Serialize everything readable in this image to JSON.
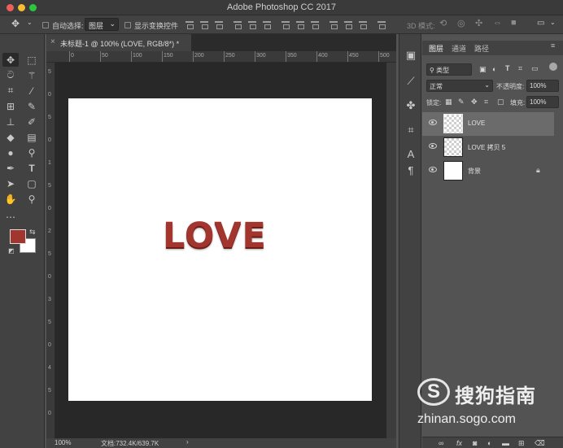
{
  "window": {
    "title": "Adobe Photoshop CC 2017",
    "traffic_colors": [
      "#ee5f57",
      "#f5bd2f",
      "#2bc640"
    ]
  },
  "options": {
    "auto_select_label": "自动选择:",
    "auto_select_value": "图层",
    "show_transform_label": "显示变换控件",
    "mode_3d_label": "3D 模式:"
  },
  "document": {
    "tab_title": "未标题-1 @ 100% (LOVE, RGB/8*) *",
    "text_layer_content": "LOVE",
    "text_color": "#a2352d",
    "ruler_top": [
      "0",
      "50",
      "100",
      "150",
      "200",
      "250",
      "300",
      "350",
      "400",
      "450",
      "500"
    ],
    "ruler_left": [
      "5",
      "0",
      "5",
      "0",
      "1",
      "5",
      "0",
      "2",
      "5",
      "0",
      "3",
      "5",
      "0",
      "4",
      "5",
      "0"
    ]
  },
  "status": {
    "zoom": "100%",
    "doc_info": "文档:732.4K/639.7K"
  },
  "toolbar": {
    "foreground_color": "#a2352d",
    "background_color": "#ffffff",
    "tools": [
      "move-tool",
      "marquee-tool",
      "lasso-tool",
      "magic-wand-tool",
      "crop-tool",
      "eyedropper-tool",
      "healing-tool",
      "brush-tool",
      "stamp-tool",
      "history-brush-tool",
      "eraser-tool",
      "gradient-tool",
      "blur-tool",
      "dodge-tool",
      "pen-tool",
      "type-tool",
      "path-select-tool",
      "shape-tool",
      "hand-tool",
      "zoom-tool",
      "more-tools"
    ]
  },
  "layers_panel": {
    "tabs": [
      "图层",
      "通道",
      "路径"
    ],
    "filter_label": "类型",
    "blend_mode": "正常",
    "opacity_label": "不透明度:",
    "opacity_value": "100%",
    "lock_label": "锁定:",
    "fill_label": "填充:",
    "fill_value": "100%",
    "layers": [
      {
        "name": "LOVE",
        "selected": true,
        "locked": false
      },
      {
        "name": "LOVE 拷贝 5",
        "selected": false,
        "locked": false
      },
      {
        "name": "背景",
        "selected": false,
        "locked": true
      }
    ]
  },
  "watermark": {
    "brand": "搜狗指南",
    "url": "zhinan.sogo.com"
  }
}
